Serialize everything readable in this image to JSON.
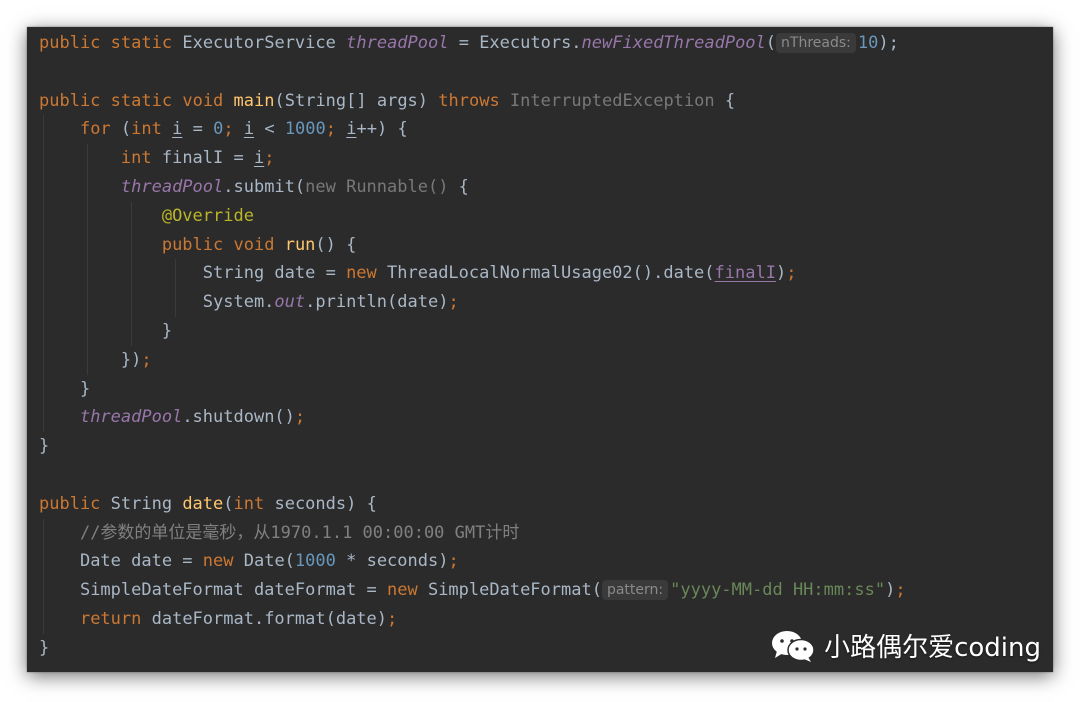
{
  "editor": {
    "line1": {
      "kw1": "public",
      "kw2": "static",
      "type": "ExecutorService",
      "field": "threadPool",
      "eq": " = Executors.",
      "method": "newFixedThreadPool",
      "open": "(",
      "hint": "nThreads:",
      "num": "10",
      "close": ");"
    },
    "line3": {
      "kw1": "public",
      "kw2": "static",
      "kw3": "void",
      "method": "main",
      "params": "(String[] args) ",
      "throws": "throws",
      "exception": " InterruptedException",
      "brace": " {"
    },
    "line4": {
      "for": "for",
      "p1": " (",
      "int": "int",
      "sp": " ",
      "i1": "i",
      "eq": " = ",
      "zero": "0",
      "semi1": ";",
      "sp2": " ",
      "i2": "i",
      "lt": " < ",
      "thousand": "1000",
      "semi2": ";",
      "sp3": " ",
      "i3": "i",
      "inc": "++) {"
    },
    "line5": {
      "int": "int",
      "decl": " finalI = ",
      "i": "i",
      "semi": ";"
    },
    "line6": {
      "field": "threadPool",
      "submit": ".submit(",
      "new": "new Runnable()",
      "brace": " {"
    },
    "line7": {
      "annotation": "@Override"
    },
    "line8": {
      "kw1": "public",
      "kw2": "void",
      "method": "run",
      "rest": "() {"
    },
    "line9": {
      "decl": "String date = ",
      "new": "new",
      "call": " ThreadLocalNormalUsage02().date(",
      "captured": "finalI",
      "close": ")",
      "semi": ";"
    },
    "line10": {
      "system": "System.",
      "out": "out",
      "println": ".println(date)",
      "semi": ";"
    },
    "line11": {
      "text": "}"
    },
    "line12": {
      "text": "})",
      "semi": ";"
    },
    "line13": {
      "text": "}"
    },
    "line14": {
      "field": "threadPool",
      "call": ".shutdown()",
      "semi": ";"
    },
    "line15": {
      "text": "}"
    },
    "line17": {
      "kw1": "public",
      "type": " String ",
      "method": "date",
      "open": "(",
      "int": "int",
      "rest": " seconds) {"
    },
    "line18": {
      "comment": "//参数的单位是毫秒，从1970.1.1 00:00:00 GMT计时"
    },
    "line19": {
      "decl": "Date date = ",
      "new": "new",
      "call": " Date(",
      "num": "1000",
      "rest": " * seconds)",
      "semi": ";"
    },
    "line20": {
      "decl": "SimpleDateFormat dateFormat = ",
      "new": "new",
      "call": " SimpleDateFormat(",
      "hint": "pattern:",
      "str": "\"yyyy-MM-dd HH:mm:ss\"",
      "close": ")",
      "semi": ";"
    },
    "line21": {
      "return": "return",
      "rest": " dateFormat.format(date)",
      "semi": ";"
    },
    "line22": {
      "text": "}"
    }
  },
  "watermark": {
    "icon": "wechat-icon",
    "text": "小路偶尔爱coding"
  }
}
